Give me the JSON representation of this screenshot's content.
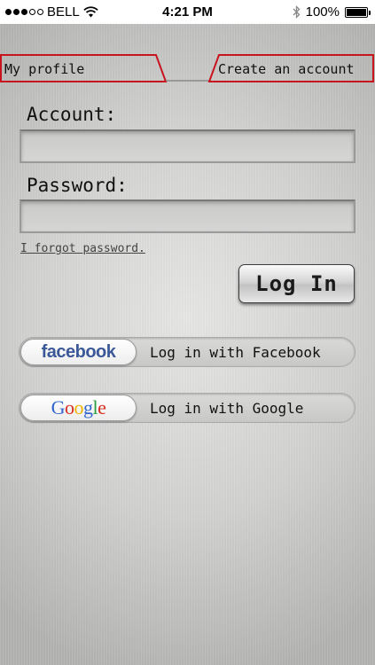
{
  "status_bar": {
    "carrier": "BELL",
    "time": "4:21 PM",
    "battery": "100%"
  },
  "tabs": [
    {
      "label": "My profile"
    },
    {
      "label": "Create an account"
    }
  ],
  "colors": {
    "tab_border": "#c8141e",
    "facebook_blue": "#3b5998"
  },
  "form": {
    "account_label": "Account:",
    "account_value": "",
    "password_label": "Password:",
    "password_value": "",
    "forgot_link": "I forgot password.",
    "login_button": "Log In"
  },
  "social": {
    "facebook": {
      "logo": "facebook",
      "label": "Log in with Facebook"
    },
    "google": {
      "logo": "Google",
      "label": "Log in with Google"
    }
  }
}
